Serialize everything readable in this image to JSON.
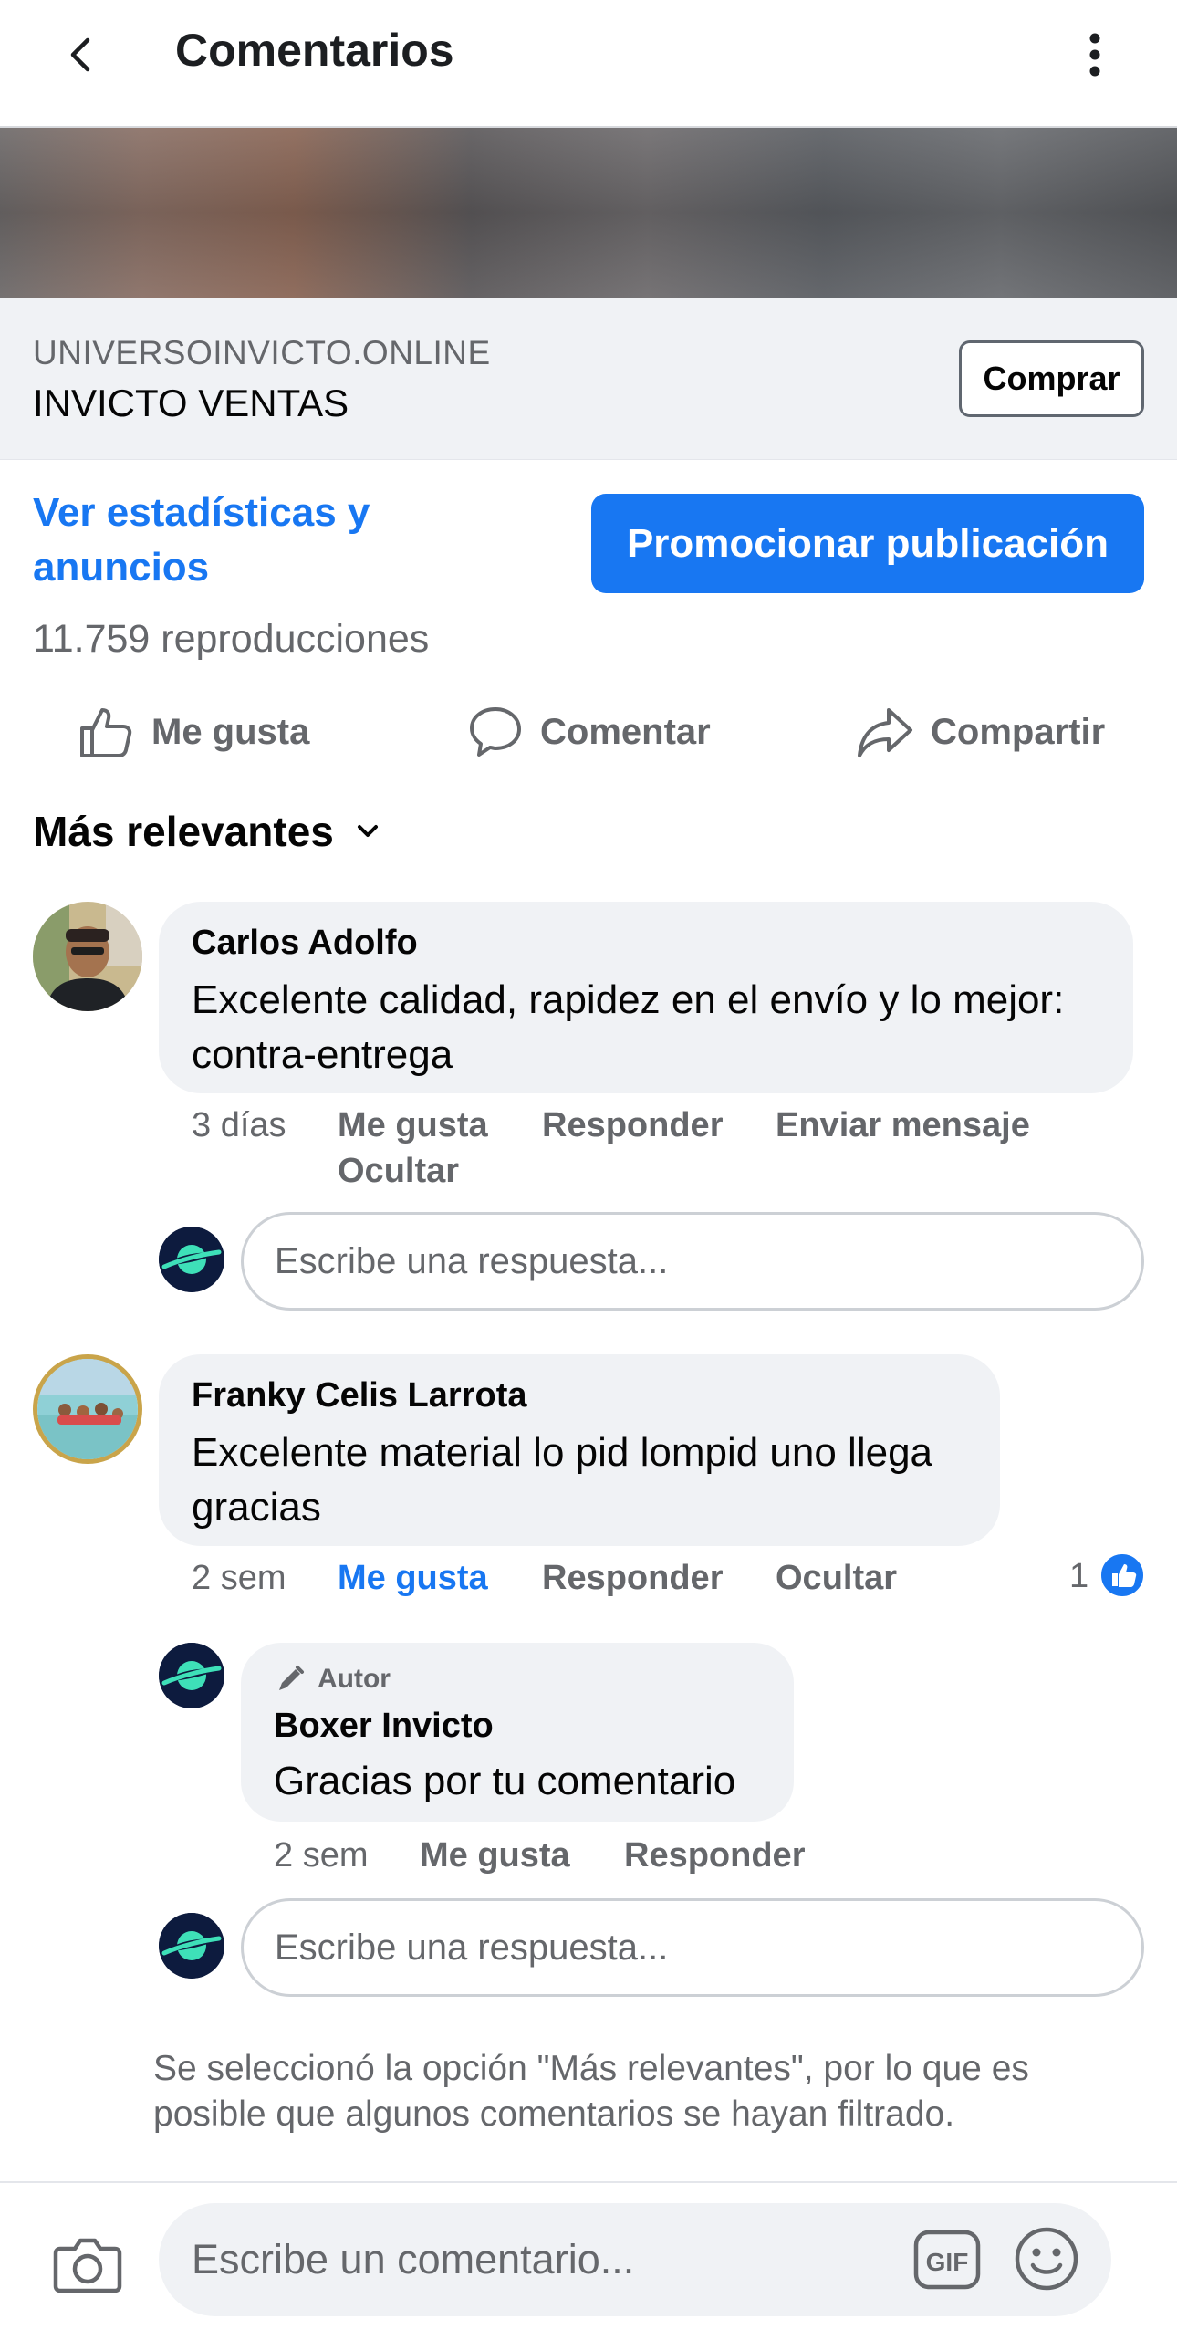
{
  "header": {
    "title": "Comentarios",
    "back_icon": "chevron-left-icon",
    "more_icon": "more-vertical-icon"
  },
  "link_preview": {
    "domain": "UNIVERSOINVICTO.ONLINE",
    "name": "INVICTO VENTAS",
    "button": "Comprar"
  },
  "insights": {
    "stats_link": "Ver estadísticas y anuncios",
    "promote_button": "Promocionar publicación",
    "views": "11.759 reproducciones"
  },
  "actions": {
    "like": "Me gusta",
    "comment": "Comentar",
    "share": "Compartir"
  },
  "sort": {
    "label": "Más relevantes"
  },
  "comments": [
    {
      "author": "Carlos Adolfo",
      "text": "Excelente calidad, rapidez en el envío y lo mejor: contra-entrega",
      "time": "3 días",
      "like": "Me gusta",
      "reply": "Responder",
      "message": "Enviar mensaje",
      "hide": "Ocultar"
    },
    {
      "author": "Franky Celis Larrota",
      "text": "Excelente material lo pid lompid uno llega gracias",
      "time": "2 sem",
      "like": "Me gusta",
      "reply": "Responder",
      "hide": "Ocultar",
      "like_count": "1",
      "replies": [
        {
          "badge": "Autor",
          "author": "Boxer Invicto",
          "text": "Gracias por tu comentario",
          "time": "2 sem",
          "like": "Me gusta",
          "reply": "Responder"
        }
      ]
    }
  ],
  "reply_placeholder": "Escribe una respuesta...",
  "filter_note": "Se seleccionó la opción \"Más relevantes\", por lo que es posible que algunos comentarios se hayan filtrado.",
  "composer": {
    "placeholder": "Escribe un comentario...",
    "gif_label": "GIF"
  },
  "colors": {
    "accent": "#1877f2",
    "bubble": "#f0f2f5",
    "secondary_text": "#65676b",
    "page_avatar": "#0d1b3e"
  }
}
